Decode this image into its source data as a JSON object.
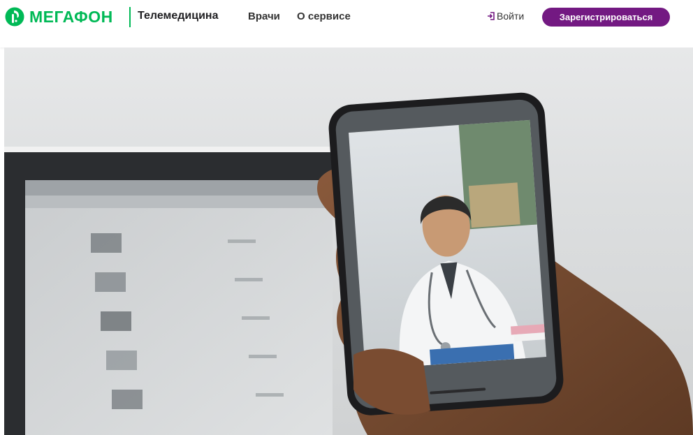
{
  "brand": {
    "name": "МегаФон",
    "product": "Телемедицина",
    "colors": {
      "green": "#00b956",
      "purple": "#731982"
    }
  },
  "nav": {
    "items": [
      {
        "label": "Врачи"
      },
      {
        "label": "О сервисе"
      }
    ]
  },
  "auth": {
    "login_label": "Войти",
    "login_icon": "login-icon",
    "register_label": "Зарегистрироваться"
  },
  "hero": {
    "image": "hand-holding-smartphone-video-call-with-doctor-photo"
  }
}
